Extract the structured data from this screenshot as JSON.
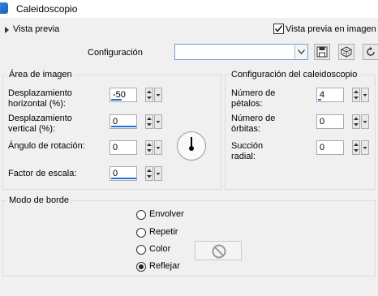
{
  "window": {
    "title": "Caleidoscopio"
  },
  "preview": {
    "label": "Vista previa",
    "checkbox_label": "Vista previa en imagen",
    "checked": true
  },
  "config": {
    "label": "Configuración",
    "value": ""
  },
  "toolbar": {
    "icons": [
      "save-icon",
      "random-dice-icon",
      "reset-icon"
    ]
  },
  "image_area": {
    "title": "Área de imagen",
    "horizontal_label_1": "Desplazamiento",
    "horizontal_label_2": "horizontal (%):",
    "horizontal_value": "-50",
    "vertical_label_1": "Desplazamiento",
    "vertical_label_2": "vertical (%):",
    "vertical_value": "0",
    "rotation_label": "Ángulo de rotación:",
    "rotation_value": "0",
    "scale_label": "Factor de escala:",
    "scale_value": "0"
  },
  "kaleido": {
    "title": "Configuración del caleidoscopio",
    "petals_label_1": "Número de",
    "petals_label_2": "pétalos:",
    "petals_value": "4",
    "orbits_label_1": "Número de",
    "orbits_label_2": "órbitas:",
    "orbits_value": "0",
    "suction_label_1": "Succión",
    "suction_label_2": "radial:",
    "suction_value": "0"
  },
  "border_mode": {
    "title": "Modo de borde",
    "options": [
      "Envolver",
      "Repetir",
      "Color",
      "Reflejar"
    ],
    "selected": "Reflejar"
  }
}
